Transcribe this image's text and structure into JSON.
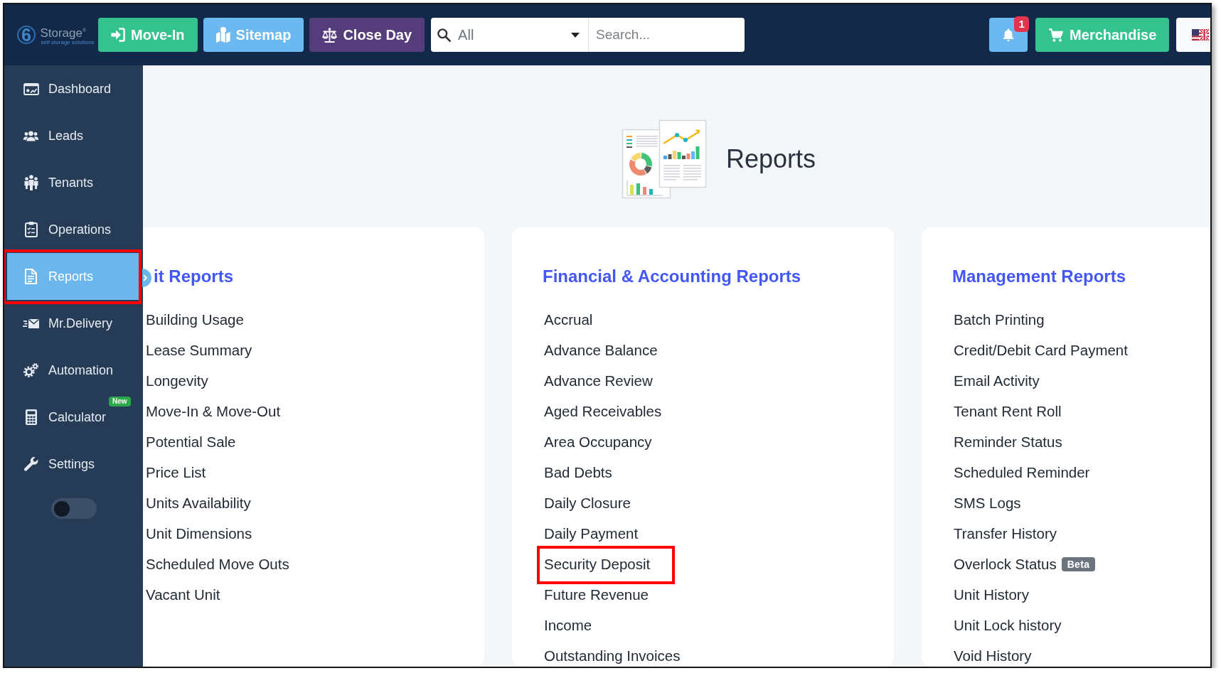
{
  "logo": {
    "mark": "6",
    "name": "Storage$^{®}$",
    "tagline": "self storage solutions"
  },
  "toolbar": {
    "buttons": [
      {
        "label": "Move-In",
        "kind": "move-in"
      },
      {
        "label": "Sitemap",
        "kind": "sitemap"
      },
      {
        "label": "Close Day",
        "kind": "close-day"
      }
    ],
    "scope": "All",
    "search": {
      "placeholder": "Search..."
    },
    "notifications": {
      "count": "1"
    },
    "merchandise": {
      "label": "Merchandise"
    }
  },
  "sidebar": {
    "items": [
      {
        "label": "Dashboard",
        "kind": "dashboard",
        "selected": false,
        "highlighted": false
      },
      {
        "label": "Leads",
        "kind": "leads",
        "selected": false,
        "highlighted": false
      },
      {
        "label": "Tenants",
        "kind": "tenants",
        "selected": false,
        "highlighted": false
      },
      {
        "label": "Operations",
        "kind": "operations",
        "selected": false,
        "highlighted": false
      },
      {
        "label": "Reports",
        "kind": "reports",
        "selected": true,
        "highlighted": true
      },
      {
        "label": "Mr.Delivery",
        "kind": "delivery",
        "selected": false,
        "highlighted": false
      },
      {
        "label": "Automation",
        "kind": "automation",
        "selected": false,
        "highlighted": false
      },
      {
        "label": "Calculator",
        "kind": "calculator",
        "selected": false,
        "highlighted": false,
        "badge": "New"
      },
      {
        "label": "Settings",
        "kind": "settings",
        "selected": false,
        "highlighted": false
      }
    ],
    "dark_mode": {
      "on": false
    }
  },
  "page": {
    "title": "Reports"
  },
  "report_groups": [
    {
      "title": "it Reports",
      "items": [
        {
          "label": "Building Usage",
          "highlighted": false
        },
        {
          "label": "Lease Summary",
          "highlighted": false
        },
        {
          "label": "Longevity",
          "highlighted": false
        },
        {
          "label": "Move-In & Move-Out",
          "highlighted": false
        },
        {
          "label": "Potential Sale",
          "highlighted": false
        },
        {
          "label": "Price List",
          "highlighted": false
        },
        {
          "label": "Units Availability",
          "highlighted": false
        },
        {
          "label": "Unit Dimensions",
          "highlighted": false
        },
        {
          "label": "Scheduled Move Outs",
          "highlighted": false
        },
        {
          "label": "Vacant Unit",
          "highlighted": false
        }
      ]
    },
    {
      "title": "Financial & Accounting Reports",
      "items": [
        {
          "label": "Accrual",
          "highlighted": false
        },
        {
          "label": "Advance Balance",
          "highlighted": false
        },
        {
          "label": "Advance Review",
          "highlighted": false
        },
        {
          "label": "Aged Receivables",
          "highlighted": false
        },
        {
          "label": "Area Occupancy",
          "highlighted": false
        },
        {
          "label": "Bad Debts",
          "highlighted": false
        },
        {
          "label": "Daily Closure",
          "highlighted": false
        },
        {
          "label": "Daily Payment",
          "highlighted": false
        },
        {
          "label": "Security Deposit",
          "highlighted": true
        },
        {
          "label": "Future Revenue",
          "highlighted": false
        },
        {
          "label": "Income",
          "highlighted": false
        },
        {
          "label": "Outstanding Invoices",
          "highlighted": false
        }
      ]
    },
    {
      "title": "Management Reports",
      "items": [
        {
          "label": "Batch Printing",
          "highlighted": false
        },
        {
          "label": "Credit/Debit Card Payment",
          "highlighted": false
        },
        {
          "label": "Email Activity",
          "highlighted": false
        },
        {
          "label": "Tenant Rent Roll",
          "highlighted": false
        },
        {
          "label": "Reminder Status",
          "highlighted": false
        },
        {
          "label": "Scheduled Reminder",
          "highlighted": false
        },
        {
          "label": "SMS Logs",
          "highlighted": false
        },
        {
          "label": "Transfer History",
          "highlighted": false
        },
        {
          "label": "Overlock Status",
          "highlighted": false,
          "badge": "Beta"
        },
        {
          "label": "Unit History",
          "highlighted": false
        },
        {
          "label": "Unit Lock history",
          "highlighted": false
        },
        {
          "label": "Void History",
          "highlighted": false
        }
      ]
    }
  ]
}
